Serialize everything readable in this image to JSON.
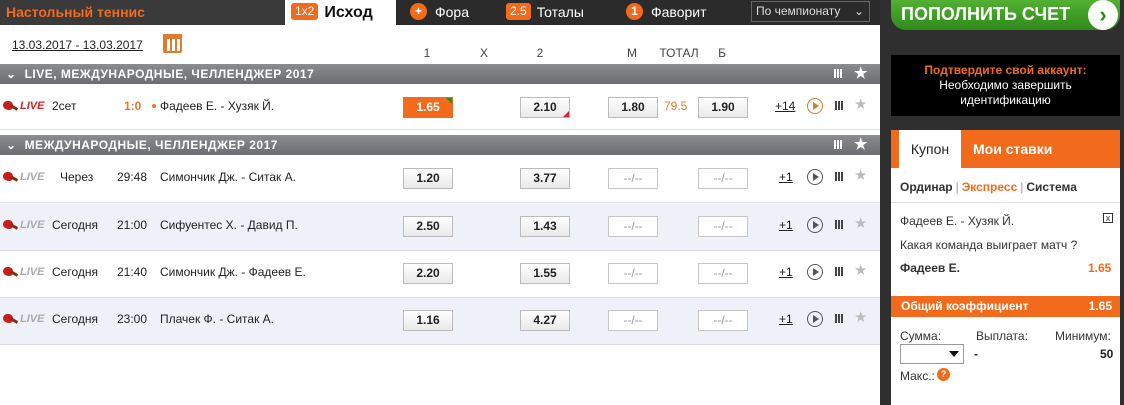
{
  "header": {
    "sport_title": "Настольный теннис",
    "tabs": [
      {
        "badge": "1x2",
        "label": "Исход"
      },
      {
        "badge": "+",
        "label": "Фора"
      },
      {
        "badge": "2.5",
        "label": "Тоталы"
      },
      {
        "badge": "1",
        "label": "Фаворит"
      }
    ],
    "filter_select": "По чемпионату"
  },
  "date_range": "13.03.2017 - 13.03.2017",
  "columns": {
    "c1": "1",
    "cx": "X",
    "c2": "2",
    "m": "М",
    "total": "ТОТАЛ",
    "b": "Б"
  },
  "sections": [
    {
      "title": "LIVE,  МЕЖДУНАРОДНЫЕ, ЧЕЛЛЕНДЖЕР 2017",
      "events": [
        {
          "live": "LIVE",
          "period": "2сет",
          "score": "1:0",
          "teams": "Фадеев Е. - Хузяк Й.",
          "odd1": "1.65",
          "odd2": "2.10",
          "m": "1.80",
          "total": "79.5",
          "b": "1.90",
          "more": "+14"
        }
      ]
    },
    {
      "title": "МЕЖДУНАРОДНЫЕ, ЧЕЛЛЕНДЖЕР 2017",
      "events": [
        {
          "live": "LIVE",
          "when": "Через",
          "time": "29:48",
          "teams": "Симончик Дж. - Ситак А.",
          "odd1": "1.20",
          "odd2": "3.77",
          "m": "--/--",
          "b": "--/--",
          "more": "+1"
        },
        {
          "live": "LIVE",
          "when": "Сегодня",
          "time": "21:00",
          "teams": "Сифуентес Х. - Давид П.",
          "odd1": "2.50",
          "odd2": "1.43",
          "m": "--/--",
          "b": "--/--",
          "more": "+1"
        },
        {
          "live": "LIVE",
          "when": "Сегодня",
          "time": "21:40",
          "teams": "Симончик Дж. - Фадеев Е.",
          "odd1": "2.20",
          "odd2": "1.55",
          "m": "--/--",
          "b": "--/--",
          "more": "+1"
        },
        {
          "live": "LIVE",
          "when": "Сегодня",
          "time": "23:00",
          "teams": "Плачек Ф. - Ситак А.",
          "odd1": "1.16",
          "odd2": "4.27",
          "m": "--/--",
          "b": "--/--",
          "more": "+1"
        }
      ]
    }
  ],
  "right_panel": {
    "topup_button": "ПОПОЛНИТЬ СЧЕТ",
    "verify_title": "Подтвердите свой аккаунт:",
    "verify_line1": "Необходимо завершить",
    "verify_line2": "идентификацию",
    "coupon_tab": "Купон",
    "my_bets_tab": "Мои ставки",
    "bet_types": [
      "Ординар",
      "Экспресс",
      "Система"
    ],
    "bet_match": "Фадеев Е. - Хузяк Й.",
    "bet_question": "Какая команда выиграет матч ?",
    "bet_pick": "Фадеев Е.",
    "bet_odd": "1.65",
    "total_label": "Общий коэффициент",
    "total_value": "1.65",
    "sum_label": "Сумма:",
    "payout_label": "Выплата:",
    "payout_value": "-",
    "min_label": "Минимум:",
    "min_value": "50",
    "max_label": "Макс.:"
  },
  "colors": {
    "accent": "#f26b1d",
    "green": "#3c9d24",
    "dark": "#2b2b2b"
  }
}
